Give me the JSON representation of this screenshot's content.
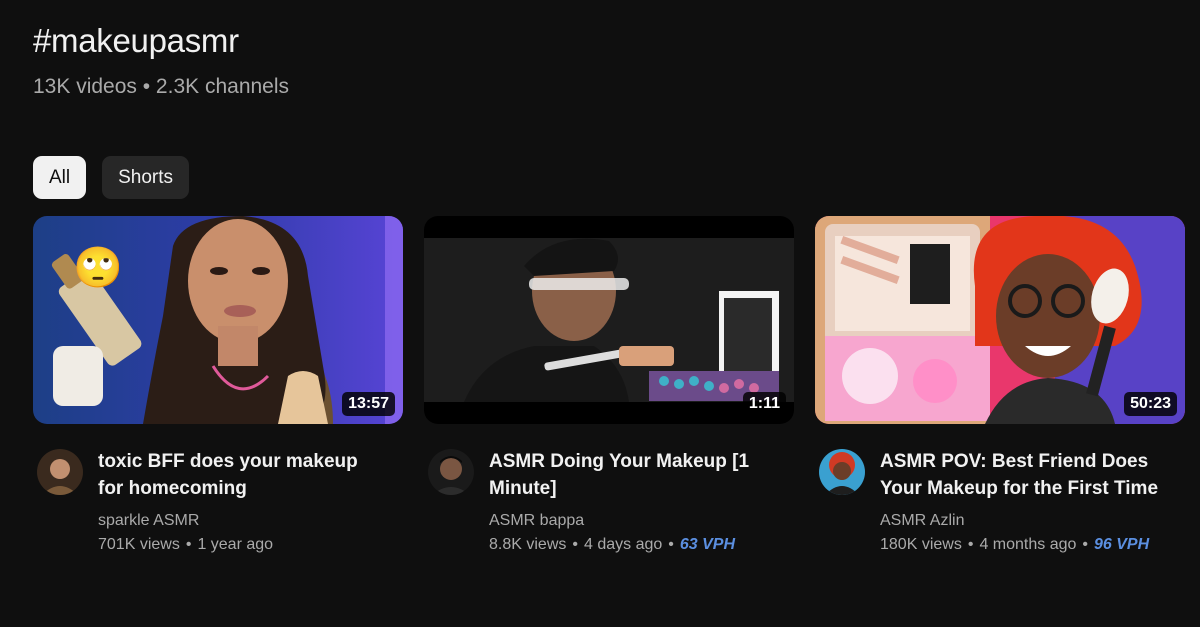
{
  "header": {
    "title": "#makeupasmr",
    "subtitle": "13K videos • 2.3K channels"
  },
  "filters": [
    {
      "label": "All",
      "selected": true
    },
    {
      "label": "Shorts",
      "selected": false
    }
  ],
  "videos": [
    {
      "title": "toxic BFF does your makeup for homecoming",
      "channel": "sparkle ASMR",
      "views": "701K views",
      "age": "1 year ago",
      "vph": "",
      "duration": "13:57",
      "emoji": "🙄"
    },
    {
      "title": "ASMR Doing Your Makeup [1 Minute]",
      "channel": "ASMR bappa",
      "views": "8.8K views",
      "age": "4 days ago",
      "vph": "63 VPH",
      "duration": "1:11"
    },
    {
      "title": "ASMR POV: Best Friend Does Your Makeup for the First Time",
      "channel": "ASMR Azlin",
      "views": "180K views",
      "age": "4 months ago",
      "vph": "96 VPH",
      "duration": "50:23"
    }
  ],
  "colors": {
    "background": "#0f0f0f",
    "chip_active": "#f1f1f1",
    "chip_inactive": "#272727",
    "secondary_text": "#aaaaaa",
    "vph": "#5b8fe0"
  }
}
